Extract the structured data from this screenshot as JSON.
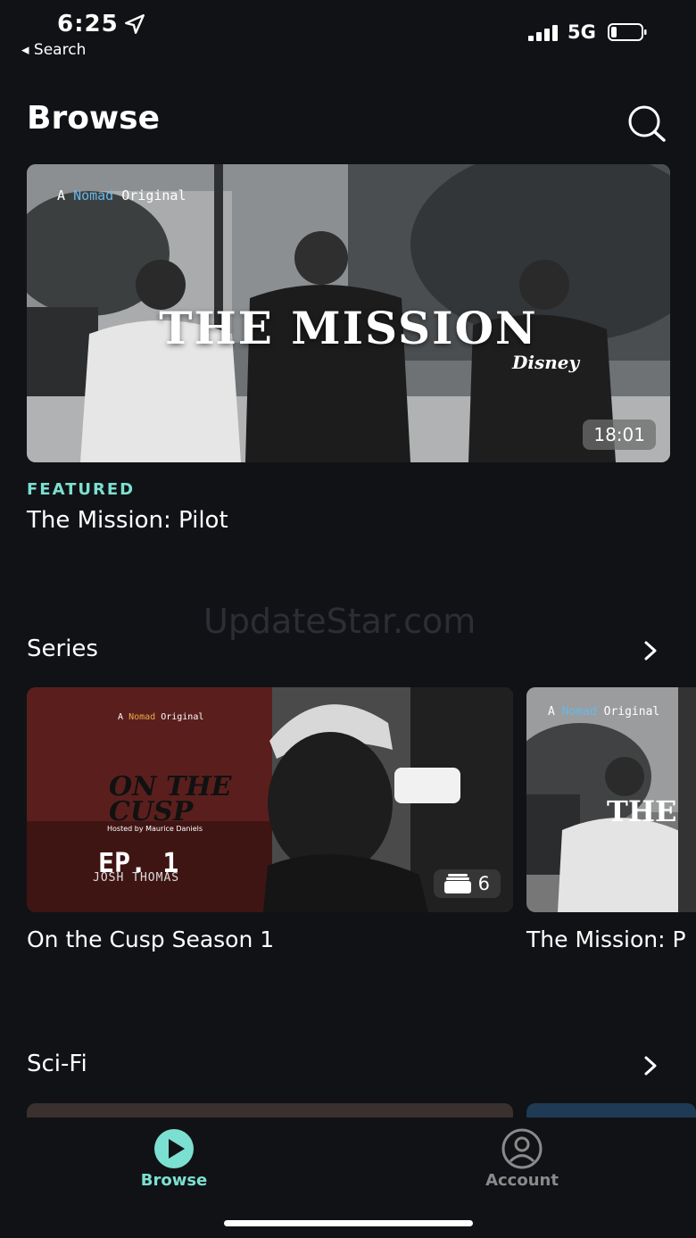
{
  "status": {
    "time": "6:25",
    "back": "◂ Search",
    "network": "5G"
  },
  "header": {
    "title": "Browse"
  },
  "featured": {
    "brand_prefix": "A",
    "brand_name": "Nomad",
    "brand_suffix": "Original",
    "headline": "THE MISSION",
    "logo": "Disney",
    "duration": "18:01",
    "tag": "FEATURED",
    "title": "The Mission: Pilot"
  },
  "watermark": "UpdateStar.com",
  "series": {
    "title": "Series",
    "cards": [
      {
        "brand_prefix": "A",
        "brand_name": "Nomad",
        "brand_suffix": "Original",
        "show_line1": "ON THE",
        "show_line2": "CUSP",
        "host": "Hosted by Maurice Daniels",
        "episode": "EP. 1",
        "guest": "JOSH THOMAS",
        "count": "6",
        "title": "On the Cusp Season 1"
      },
      {
        "brand_prefix": "A",
        "brand_name": "Nomad",
        "brand_suffix": "Original",
        "headline": "THE",
        "title": "The Mission: P"
      }
    ]
  },
  "scifi": {
    "title": "Sci-Fi"
  },
  "tabs": [
    {
      "label": "Browse",
      "active": true
    },
    {
      "label": "Account",
      "active": false
    }
  ],
  "colors": {
    "background": "#111216",
    "accent": "#7be0d1",
    "inactive": "#8a8a8a"
  }
}
